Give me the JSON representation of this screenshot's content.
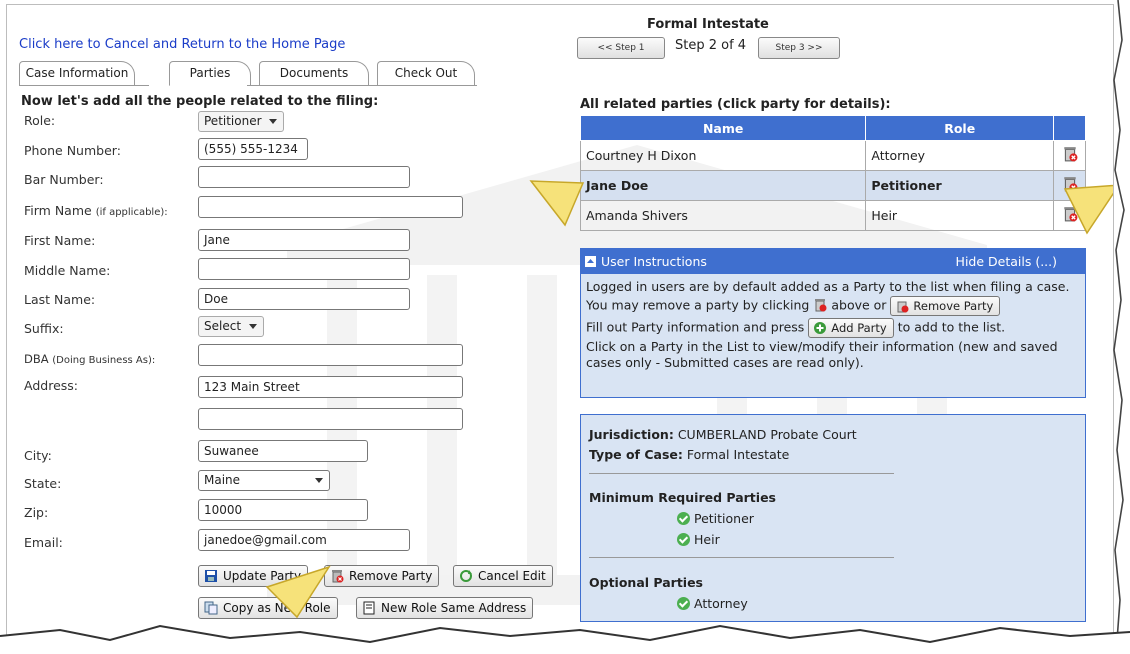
{
  "cancel_link": "Click here to Cancel and Return to the Home Page",
  "tabs": [
    {
      "label": "Case Information"
    },
    {
      "label": "Parties"
    },
    {
      "label": "Documents"
    },
    {
      "label": "Check Out"
    }
  ],
  "intro": "Now let's add all the people related to the filing:",
  "form": {
    "role_label": "Role:",
    "role_value": "Petitioner",
    "phone_label": "Phone Number:",
    "phone_value": "(555) 555-1234",
    "bar_label": "Bar Number:",
    "bar_value": "",
    "firm_label": "Firm Name",
    "firm_hint": "(if applicable):",
    "firm_value": "",
    "first_label": "First Name:",
    "first_value": "Jane",
    "middle_label": "Middle Name:",
    "middle_value": "",
    "last_label": "Last Name:",
    "last_value": "Doe",
    "suffix_label": "Suffix:",
    "suffix_value": "Select",
    "dba_label": "DBA",
    "dba_hint": "(Doing Business As):",
    "dba_value": "",
    "address_label": "Address:",
    "address_value": "123 Main Street",
    "address2_value": "",
    "city_label": "City:",
    "city_value": "Suwanee",
    "state_label": "State:",
    "state_value": "Maine",
    "zip_label": "Zip:",
    "zip_value": "10000",
    "email_label": "Email:",
    "email_value": "janedoe@gmail.com"
  },
  "buttons": {
    "update": "Update Party",
    "remove": "Remove Party",
    "cancel_edit": "Cancel Edit",
    "copy_role": "Copy as New Role",
    "new_role_same": "New Role Same Address"
  },
  "wizard": {
    "title": "Formal Intestate",
    "prev": "<< Step 1",
    "status": "Step 2 of 4",
    "next": "Step 3 >>"
  },
  "parties": {
    "title": "All related parties (click party for details):",
    "col_name": "Name",
    "col_role": "Role",
    "rows": [
      {
        "name": "Courtney H Dixon",
        "role": "Attorney"
      },
      {
        "name": "Jane Doe",
        "role": "Petitioner"
      },
      {
        "name": "Amanda Shivers",
        "role": "Heir"
      }
    ]
  },
  "instructions": {
    "title": "User Instructions",
    "hide": "Hide Details (...)",
    "line1": "Logged in users are by default added as a Party to the list when filing a case.",
    "line2a": "You may remove a party by clicking",
    "line2b": "above or",
    "remove_btn": "Remove Party",
    "line3a": "Fill out Party information and press",
    "add_btn": "Add Party",
    "line3b": "to add to the list.",
    "line4": "Click on a Party in the List to view/modify their information (new and saved cases only - Submitted cases are read only)."
  },
  "case_info": {
    "jurisdiction_label": "Jurisdiction:",
    "jurisdiction_value": "CUMBERLAND Probate Court",
    "type_label": "Type of Case:",
    "type_value": "Formal Intestate",
    "min_title": "Minimum Required Parties",
    "min_parties": [
      "Petitioner",
      "Heir"
    ],
    "opt_title": "Optional Parties",
    "opt_parties": [
      "Attorney"
    ]
  }
}
